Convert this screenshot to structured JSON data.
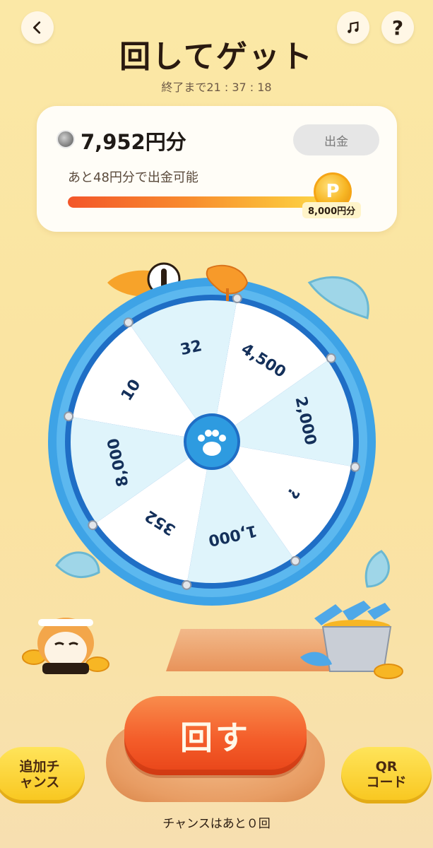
{
  "header": {
    "title": "回してゲット",
    "timer_text": "終了まで21 : 37 : 18",
    "help_label": "?"
  },
  "balance": {
    "amount": "7,952円分",
    "withdraw_label": "出金",
    "remaining_text": "あと48円分で出金可能",
    "goal_label": "8,000円分",
    "coin_symbol": "P",
    "progress": 0.994
  },
  "wheel": {
    "segments": [
      {
        "label": "4,500",
        "color": "#ffffff"
      },
      {
        "label": "2,000",
        "color": "#dff4fb"
      },
      {
        "label": "?",
        "color": "#ffffff"
      },
      {
        "label": "1,000",
        "color": "#dff4fb"
      },
      {
        "label": "352",
        "color": "#ffffff"
      },
      {
        "label": "8,000",
        "color": "#dff4fb"
      },
      {
        "label": "10",
        "color": "#ffffff"
      },
      {
        "label": "32",
        "color": "#dff4fb"
      }
    ],
    "rim_color": "#2d8fd6",
    "hub_color": "#2e9be0"
  },
  "actions": {
    "spin_label": "回す",
    "extra_chance_label": "追加チャンス",
    "qr_label": "QRコード",
    "chances_text": "チャンスはあと０回"
  }
}
